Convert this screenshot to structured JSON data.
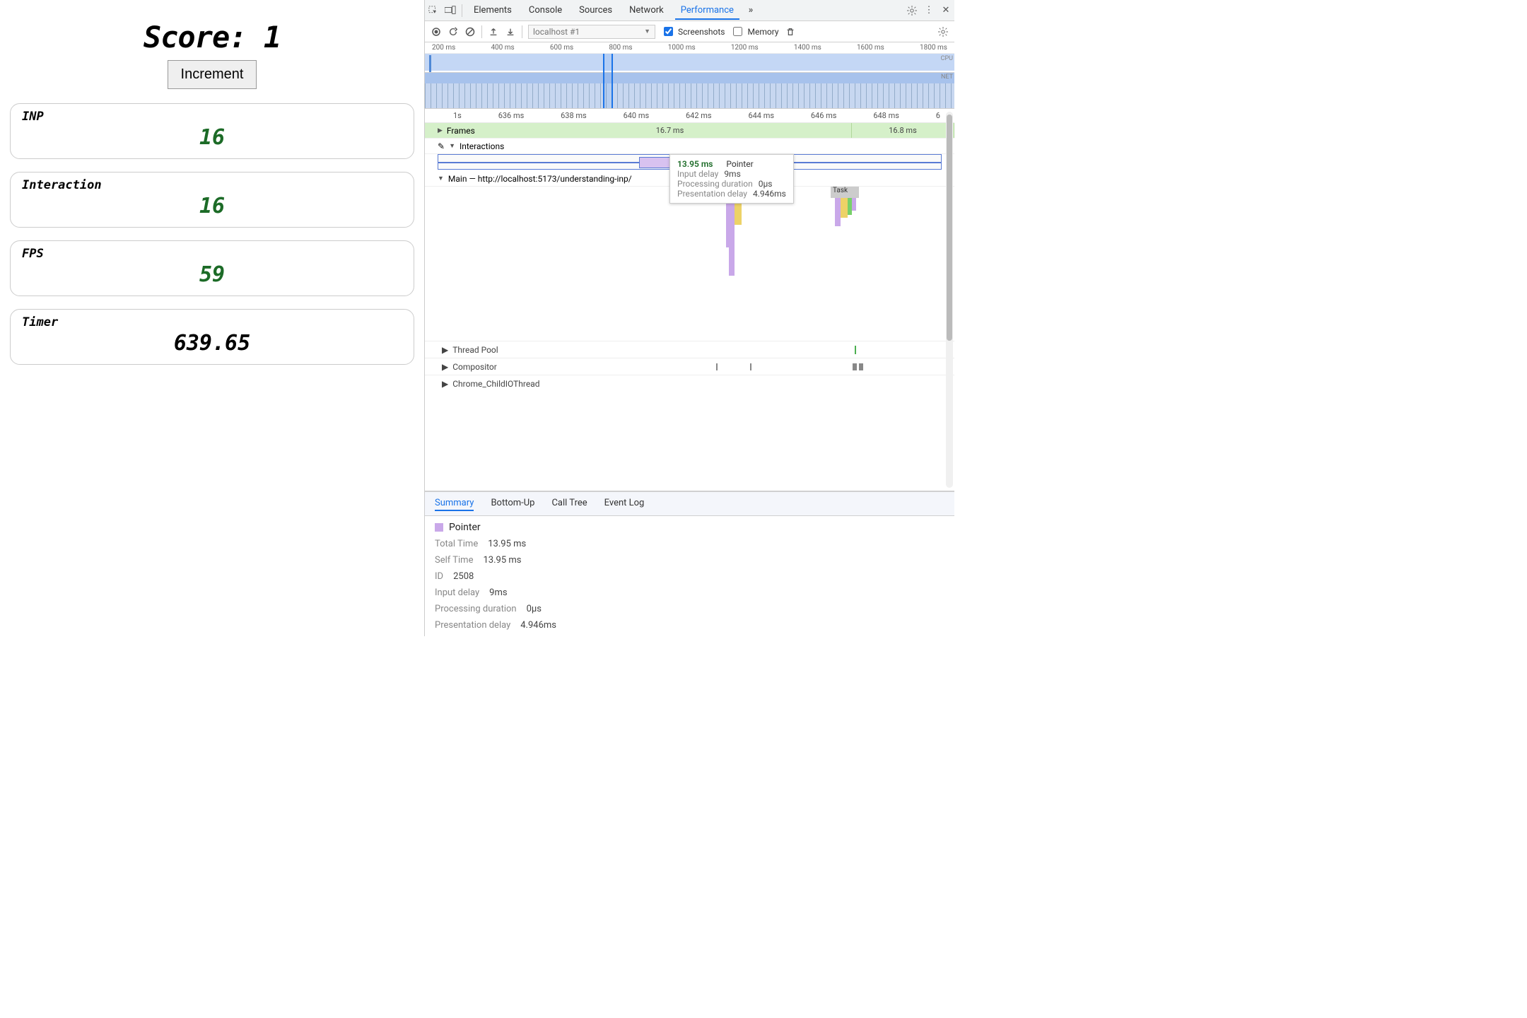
{
  "page": {
    "score_label": "Score: 1",
    "increment_label": "Increment",
    "cards": {
      "inp": {
        "title": "INP",
        "value": "16",
        "color": "green"
      },
      "inter": {
        "title": "Interaction",
        "value": "16",
        "color": "green"
      },
      "fps": {
        "title": "FPS",
        "value": "59",
        "color": "green"
      },
      "timer": {
        "title": "Timer",
        "value": "639.65",
        "color": "black"
      }
    }
  },
  "devtools": {
    "tabs": {
      "elements": "Elements",
      "console": "Console",
      "sources": "Sources",
      "network": "Network",
      "performance": "Performance"
    },
    "active_tab": "performance",
    "toolbar": {
      "source_label": "localhost #1",
      "screenshots_label": "Screenshots",
      "screenshots_checked": true,
      "memory_label": "Memory",
      "memory_checked": false
    },
    "overview": {
      "labels": [
        "200 ms",
        "400 ms",
        "600 ms",
        "800 ms",
        "1000 ms",
        "1200 ms",
        "1400 ms",
        "1600 ms",
        "1800 ms"
      ],
      "cpu_label": "CPU",
      "net_label": "NET",
      "selected_range_ms": [
        634,
        649
      ]
    },
    "flamechart": {
      "ruler": [
        "1s",
        "636 ms",
        "638 ms",
        "640 ms",
        "642 ms",
        "644 ms",
        "646 ms",
        "648 ms",
        "6"
      ],
      "frames": {
        "label": "Frames",
        "segments": [
          "16.7 ms",
          "16.8 ms"
        ]
      },
      "interactions": {
        "label": "Interactions",
        "edit_label": "✎"
      },
      "main": {
        "label": "Main — http://localhost:5173/understanding-inp/",
        "task_label": "Task"
      },
      "threads": {
        "pool": "Thread Pool",
        "compositor": "Compositor",
        "childio": "Chrome_ChildIOThread"
      }
    },
    "tooltip": {
      "time": "13.95 ms",
      "kind": "Pointer",
      "rows": [
        {
          "k": "Input delay",
          "v": "9ms"
        },
        {
          "k": "Processing duration",
          "v": "0µs"
        },
        {
          "k": "Presentation delay",
          "v": "4.946ms"
        }
      ]
    },
    "details_tabs": {
      "summary": "Summary",
      "bottomup": "Bottom-Up",
      "calltree": "Call Tree",
      "eventlog": "Event Log"
    },
    "details_active": "summary",
    "summary": {
      "title": "Pointer",
      "rows": [
        {
          "k": "Total Time",
          "v": "13.95 ms"
        },
        {
          "k": "Self Time",
          "v": "13.95 ms"
        },
        {
          "k": "ID",
          "v": "2508"
        },
        {
          "k": "Input delay",
          "v": "9ms"
        },
        {
          "k": "Processing duration",
          "v": "0µs"
        },
        {
          "k": "Presentation delay",
          "v": "4.946ms"
        }
      ]
    }
  }
}
